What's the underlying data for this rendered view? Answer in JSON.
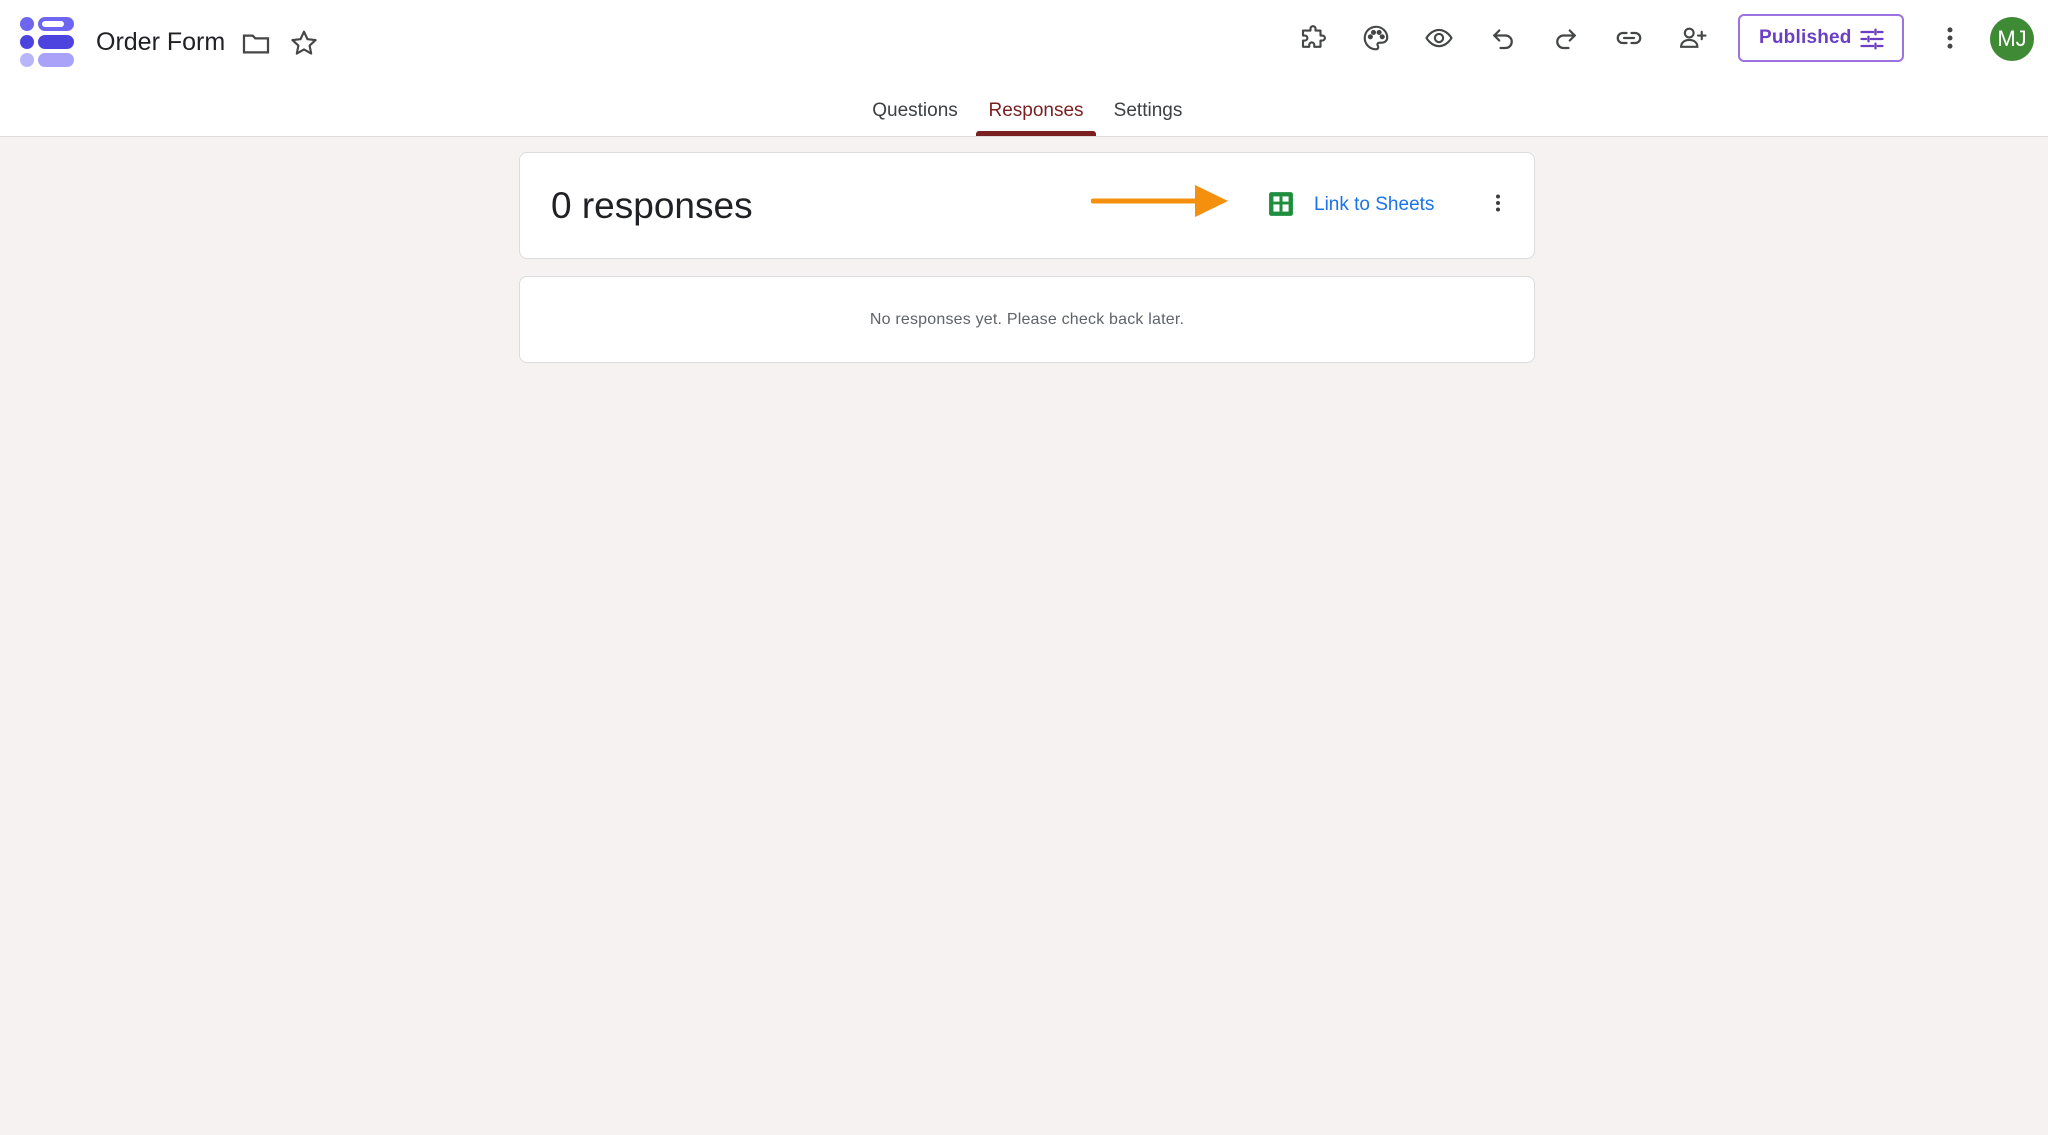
{
  "app": {
    "doc_title": "Order Form",
    "avatar_initials": "MJ",
    "publish_label": "Published"
  },
  "title_icons": [
    {
      "name": "folder-icon"
    },
    {
      "name": "star-icon"
    }
  ],
  "toolbar_icons": [
    {
      "name": "add-ons-icon"
    },
    {
      "name": "palette-icon"
    },
    {
      "name": "preview-eye-icon"
    },
    {
      "name": "undo-icon"
    },
    {
      "name": "redo-icon"
    },
    {
      "name": "link-icon"
    },
    {
      "name": "add-collaborator-icon"
    },
    {
      "name": "more-vert-icon"
    }
  ],
  "tabs": [
    {
      "label": "Questions",
      "active": false
    },
    {
      "label": "Responses",
      "active": true
    },
    {
      "label": "Settings",
      "active": false
    }
  ],
  "responses": {
    "count_label": "0 responses",
    "link_sheets_label": "Link to Sheets",
    "empty_message": "No responses yet. Please check back later."
  },
  "colors": {
    "accent": "#7a1f1f",
    "link": "#1a73e8",
    "publish": "#6a3fc4",
    "sheets_green": "#1e8e3e",
    "arrow": "#f5900f",
    "avatar_bg": "#3f8a35",
    "page_bg": "#f6f2f2"
  }
}
